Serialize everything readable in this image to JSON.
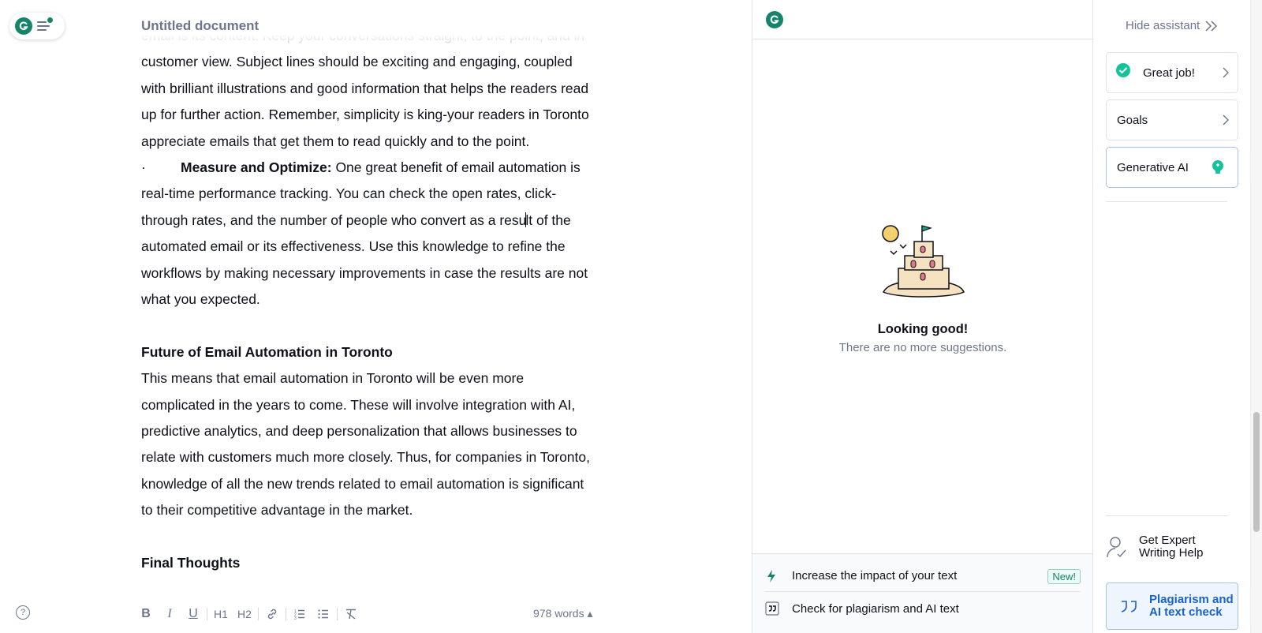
{
  "editor": {
    "title": "Untitled document",
    "paragraphs": {
      "p1_l0": "email is its content. Keep your conversations straight, to the point, and in",
      "p1_l1": "customer view. Subject lines should be exciting and engaging, coupled",
      "p1_l2": "with brilliant illustrations and good information that helps the readers read",
      "p1_l3": "up for further action. Remember, simplicity is king-your readers in Toronto",
      "p1_l4": "appreciate emails that get them to read quickly and to the point.",
      "bullet_mark": "·",
      "bullet_bold": "Measure and Optimize:",
      "bullet_l0_rest": " One great benefit of email automation is",
      "bullet_l1": "real-time performance tracking. You can check the open rates, click-",
      "bullet_l2_a": "through rates, and the number of people who convert as a resu",
      "bullet_l2_b": "lt of the",
      "bullet_l3": "automated email or its effectiveness. Use this knowledge to refine the",
      "bullet_l4": "workflows by making necessary improvements in case the results are not",
      "bullet_l5": "what you expected.",
      "heading_future": "Future of Email Automation in Toronto",
      "future_l0": "This means that email automation in Toronto will be even more",
      "future_l1": "complicated in the years to come. These will involve integration with AI,",
      "future_l2": "predictive analytics, and deep personalization that allows businesses to",
      "future_l3": "relate with customers much more closely. Thus, for companies in Toronto,",
      "future_l4": "knowledge of all the new trends related to email automation is significant",
      "future_l5": "to their competitive advantage in the market.",
      "heading_final": "Final Thoughts"
    },
    "toolbar": {
      "bold": "B",
      "italic": "I",
      "underline": "U",
      "h1": "H1",
      "h2": "H2"
    },
    "word_count": "978 words ▴",
    "help_glyph": "?"
  },
  "assistant": {
    "empty_title": "Looking good!",
    "empty_subtitle": "There are no more suggestions.",
    "promo_impact": "Increase the impact of your text",
    "promo_badge": "New!",
    "promo_plagiarism": "Check for plagiarism and AI text"
  },
  "sidebar": {
    "hide_label": "Hide assistant",
    "great_job": "Great job!",
    "goals": "Goals",
    "generative_ai": "Generative AI",
    "expert_line1": "Get Expert",
    "expert_line2": "Writing Help",
    "plag_line1": "Plagiarism and",
    "plag_line2": "AI text check"
  },
  "colors": {
    "brand_green": "#15846a",
    "link_blue": "#1a62c5",
    "muted": "#6d758d"
  },
  "icons": [
    "grammarly-logo-icon",
    "menu-icon",
    "help-icon",
    "bold-icon",
    "italic-icon",
    "underline-icon",
    "heading1-icon",
    "heading2-icon",
    "link-icon",
    "numbered-list-icon",
    "bulleted-list-icon",
    "clear-format-icon",
    "sandcastle-illustration",
    "lightning-icon",
    "quote-icon",
    "double-chevron-right-icon",
    "check-circle-icon",
    "chevron-right-icon",
    "lightbulb-icon",
    "expert-person-icon"
  ]
}
